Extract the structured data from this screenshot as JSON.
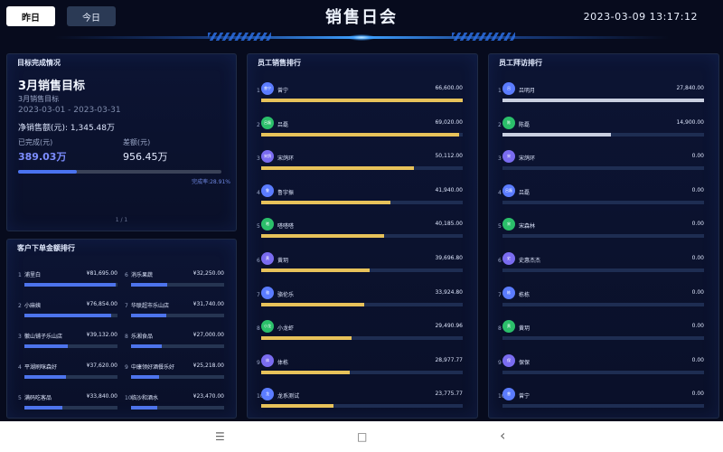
{
  "header": {
    "yesterday_label": "昨日",
    "today_label": "今日",
    "title": "销售日会",
    "datetime": "2023-03-09 13:17:12"
  },
  "target": {
    "panel_title": "目标完成情况",
    "big_title": "3月销售目标",
    "subtitle": "3月销售目标",
    "date_range": "2023-03-01 - 2023-03-31",
    "net_sales": "净销售额(元): 1,345.48万",
    "completed_label": "已完成(元)",
    "completed_value": "389.03万",
    "diff_label": "差额(元)",
    "diff_value": "956.45万",
    "rate_text": "完成率:28.91%",
    "rate_fraction": 0.2891,
    "pager": "1 / 1"
  },
  "customers": {
    "panel_title": "客户下单金额排行",
    "items": [
      {
        "rank": "1",
        "name": "浦里白",
        "amount": "¥81,695.00",
        "fill": 0.98
      },
      {
        "rank": "2",
        "name": "小麻姨",
        "amount": "¥76,854.00",
        "fill": 0.93
      },
      {
        "rank": "3",
        "name": "徽山铺子乐山店",
        "amount": "¥39,132.00",
        "fill": 0.47
      },
      {
        "rank": "4",
        "name": "平湖刷咪森好",
        "amount": "¥37,620.00",
        "fill": 0.45
      },
      {
        "rank": "5",
        "name": "满码吃客品",
        "amount": "¥33,840.00",
        "fill": 0.41
      },
      {
        "rank": "6",
        "name": "消乐果蔬",
        "amount": "¥32,250.00",
        "fill": 0.39
      },
      {
        "rank": "7",
        "name": "华联超市乐山店",
        "amount": "¥31,740.00",
        "fill": 0.38
      },
      {
        "rank": "8",
        "name": "乐湘食品",
        "amount": "¥27,000.00",
        "fill": 0.33
      },
      {
        "rank": "9",
        "name": "中康领好酒餐乐好",
        "amount": "¥25,218.00",
        "fill": 0.3
      },
      {
        "rank": "10",
        "name": "临沙和酒水",
        "amount": "¥23,470.00",
        "fill": 0.28
      }
    ]
  },
  "emp_sales": {
    "panel_title": "员工销售排行",
    "items": [
      {
        "rank": "1",
        "avatar": "曾宁",
        "name": "曾宁",
        "amount": "66,600.00",
        "fill": 1.0,
        "color": "#5b7cff"
      },
      {
        "rank": "2",
        "avatar": "吕磊",
        "name": "吕磊",
        "amount": "69,020.00",
        "fill": 0.98,
        "color": "#2bbf6a"
      },
      {
        "rank": "3",
        "avatar": "宋鸽",
        "name": "宋鸽环",
        "amount": "50,112.00",
        "fill": 0.76,
        "color": "#7a6cf0"
      },
      {
        "rank": "4",
        "avatar": "鲁",
        "name": "鲁宇振",
        "amount": "41,940.00",
        "fill": 0.64,
        "color": "#5b7cff"
      },
      {
        "rank": "5",
        "avatar": "嗒",
        "name": "嗒嗒嗒",
        "amount": "40,185.00",
        "fill": 0.61,
        "color": "#2bbf6a"
      },
      {
        "rank": "6",
        "avatar": "黄",
        "name": "黄玥",
        "amount": "39,696.80",
        "fill": 0.54,
        "color": "#7a6cf0"
      },
      {
        "rank": "7",
        "avatar": "骆",
        "name": "骆伦乐",
        "amount": "33,924.80",
        "fill": 0.51,
        "color": "#5b7cff"
      },
      {
        "rank": "8",
        "avatar": "小龙",
        "name": "小龙虾",
        "amount": "29,490.96",
        "fill": 0.45,
        "color": "#2bbf6a"
      },
      {
        "rank": "9",
        "avatar": "体",
        "name": "体栋",
        "amount": "28,977.77",
        "fill": 0.44,
        "color": "#7a6cf0"
      },
      {
        "rank": "10",
        "avatar": "龙",
        "name": "龙系测试",
        "amount": "23,775.77",
        "fill": 0.36,
        "color": "#5b7cff"
      }
    ]
  },
  "emp_visits": {
    "panel_title": "员工拜访排行",
    "items": [
      {
        "rank": "1",
        "avatar": "吕",
        "name": "吕明月",
        "amount": "27,840.00",
        "fill": 1.0,
        "color": "#5b7cff"
      },
      {
        "rank": "2",
        "avatar": "陈",
        "name": "陈磊",
        "amount": "14,900.00",
        "fill": 0.54,
        "color": "#2bbf6a"
      },
      {
        "rank": "3",
        "avatar": "宋",
        "name": "宋鸽环",
        "amount": "0.00",
        "fill": 0.0,
        "color": "#7a6cf0"
      },
      {
        "rank": "4",
        "avatar": "吕磊",
        "name": "吕磊",
        "amount": "0.00",
        "fill": 0.0,
        "color": "#5b7cff"
      },
      {
        "rank": "5",
        "avatar": "宋",
        "name": "宋森林",
        "amount": "0.00",
        "fill": 0.0,
        "color": "#2bbf6a"
      },
      {
        "rank": "6",
        "avatar": "史",
        "name": "史惠杰杰",
        "amount": "0.00",
        "fill": 0.0,
        "color": "#7a6cf0"
      },
      {
        "rank": "7",
        "avatar": "栋",
        "name": "栋栋",
        "amount": "0.00",
        "fill": 0.0,
        "color": "#5b7cff"
      },
      {
        "rank": "8",
        "avatar": "黄",
        "name": "黄玥",
        "amount": "0.00",
        "fill": 0.0,
        "color": "#2bbf6a"
      },
      {
        "rank": "9",
        "avatar": "保",
        "name": "保保",
        "amount": "0.00",
        "fill": 0.0,
        "color": "#7a6cf0"
      },
      {
        "rank": "10",
        "avatar": "曾",
        "name": "曾宁",
        "amount": "0.00",
        "fill": 0.0,
        "color": "#5b7cff"
      }
    ]
  },
  "colors": {
    "sales_bar": "#e7c25a",
    "visit_bar": "#c9cfe0",
    "customer_bar": "#4d74ec",
    "progress": "#4a73f0"
  },
  "nav": {
    "menu_icon": "☰",
    "home_icon": "□",
    "back_icon": "‹"
  }
}
